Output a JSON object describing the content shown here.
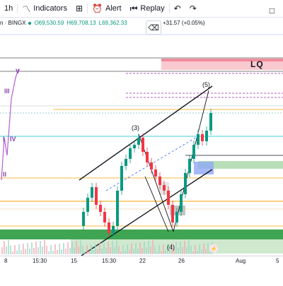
{
  "toolbar": {
    "interval": "1h",
    "indicators_label": "Indicators",
    "alert_label": "Alert",
    "replay_label": "Replay"
  },
  "legend": {
    "symbol": "n · BINGX",
    "open": "O69,530.59",
    "high": "H69,708.13",
    "low": "L69,362.33",
    "change": "+31.57 (+0.05%)"
  },
  "annotations": {
    "lq": "LQ",
    "wave_3": "(3)",
    "wave_4": "(4)",
    "wave_5": "(5)",
    "wave_roman_V": "V",
    "wave_roman_III": "III",
    "wave_roman_IV": "IV",
    "wave_roman_I": "I",
    "wave_roman_II": "II"
  },
  "time_axis": {
    "labels": [
      "8",
      "15:30",
      "15",
      "15:30",
      "22",
      "26",
      "Aug",
      "5"
    ]
  },
  "colors": {
    "up": "#089981",
    "down": "#f23645",
    "green_zone": "#4caf50",
    "red_zone": "#f7a1ad",
    "purple": "#9c27b0",
    "blue_zone": "#6d8bf0",
    "orange_line": "#f0a500"
  }
}
